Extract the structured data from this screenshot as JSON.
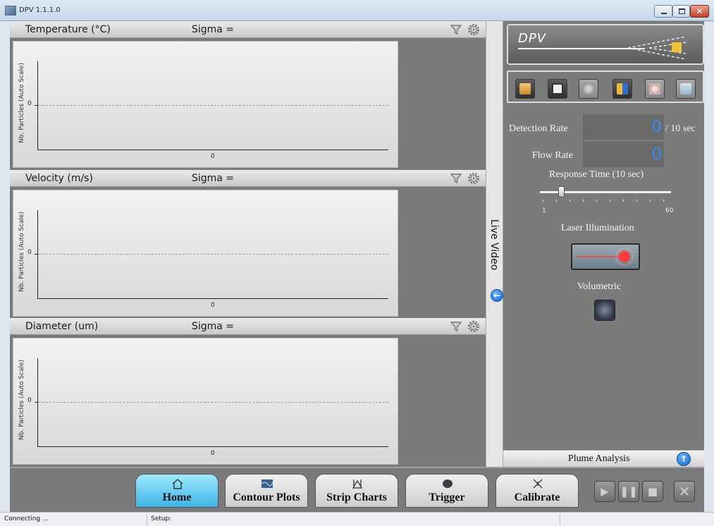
{
  "window": {
    "title": "DPV 1.1.1.0"
  },
  "charts": [
    {
      "title": "Temperature (°C)",
      "sigma": "Sigma =",
      "ylabel": "Nb. Particles (Auto Scale)",
      "y_tick": "0",
      "x_tick": "0"
    },
    {
      "title": "Velocity (m/s)",
      "sigma": "Sigma =",
      "ylabel": "Nb. Particles (Auto Scale)",
      "y_tick": "0",
      "x_tick": "0"
    },
    {
      "title": "Diameter (um)",
      "sigma": "Sigma =",
      "ylabel": "Nb. Particles (Auto Scale)",
      "y_tick": "0",
      "x_tick": "0"
    }
  ],
  "live_video": {
    "label": "Live Video"
  },
  "logo": {
    "text": "DPV"
  },
  "toolbar": {
    "icons": [
      "open-folder-icon",
      "save-icon",
      "particles-icon",
      "measure-icon",
      "target-icon",
      "cone-icon"
    ]
  },
  "readouts": {
    "detection_rate_label": "Detection Rate",
    "detection_rate_value": "0",
    "detection_rate_unit": "/ 10 sec",
    "flow_rate_label": "Flow Rate",
    "flow_rate_value": "0"
  },
  "response_time": {
    "label": "Response Time (10 sec)",
    "min": "1",
    "max": "60",
    "value": 10
  },
  "laser": {
    "label": "Laser Illumination"
  },
  "volumetric": {
    "label": "Volumetric"
  },
  "plume": {
    "label": "Plume Analysis"
  },
  "nav": [
    {
      "label": "Home",
      "icon": "home-icon",
      "active": true
    },
    {
      "label": "Contour Plots",
      "icon": "contour-icon",
      "active": false
    },
    {
      "label": "Strip Charts",
      "icon": "strip-charts-icon",
      "active": false
    },
    {
      "label": "Trigger",
      "icon": "trigger-icon",
      "active": false
    },
    {
      "label": "Calibrate",
      "icon": "calibrate-icon",
      "active": false
    }
  ],
  "status": {
    "left": "Connecting ...",
    "setup": "Setup:"
  },
  "colors": {
    "accent_blue": "#2f8cff",
    "active_tab": "#3eb4e6",
    "panel_gray": "#7b7b7b"
  }
}
